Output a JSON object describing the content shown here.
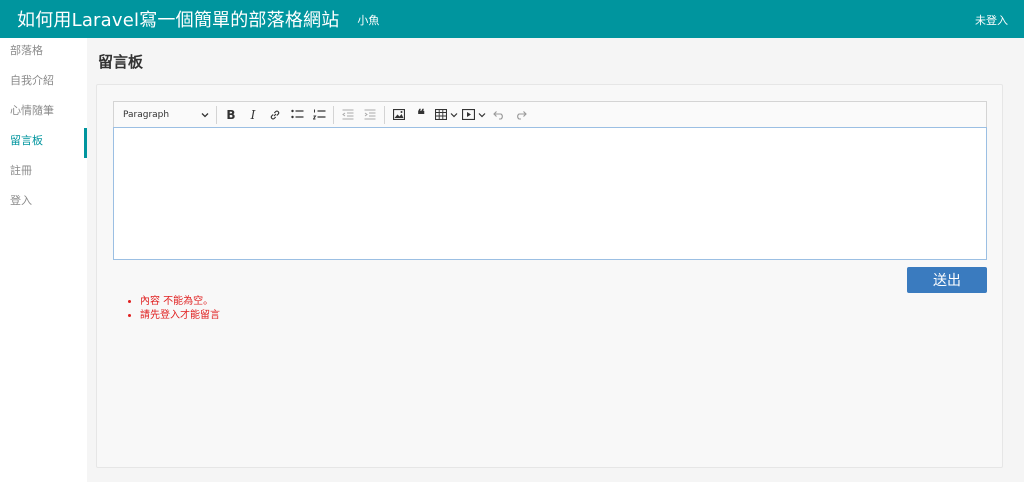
{
  "header": {
    "title": "如何用Laravel寫一個簡單的部落格網站",
    "user": "小魚",
    "login_status": "未登入"
  },
  "sidebar": {
    "items": [
      {
        "label": "部落格"
      },
      {
        "label": "自我介紹"
      },
      {
        "label": "心情隨筆"
      },
      {
        "label": "留言板"
      },
      {
        "label": "註冊"
      },
      {
        "label": "登入"
      }
    ],
    "active_index": 3
  },
  "main": {
    "title": "留言板",
    "editor": {
      "heading_select": "Paragraph",
      "content": ""
    },
    "submit_label": "送出",
    "errors": [
      "內容 不能為空。",
      "請先登入才能留言"
    ]
  },
  "colors": {
    "header_bg": "#00959e",
    "accent": "#00959e",
    "button": "#3a7bbf",
    "error": "#e02020"
  }
}
